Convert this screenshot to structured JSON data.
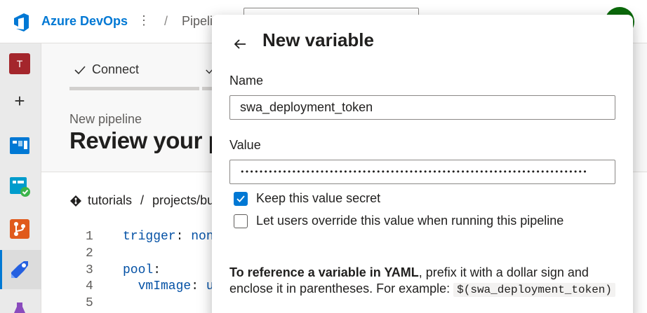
{
  "header": {
    "brand": "Azure DevOps",
    "kebab": "⋮",
    "separator": "/",
    "crumb": "Pipeli"
  },
  "leftnav": {
    "org_initial": "T",
    "plus": "+"
  },
  "main": {
    "steps": [
      {
        "label": "Connect"
      }
    ],
    "subtitle": "New pipeline",
    "title": "Review your p",
    "repo": {
      "org": "tutorials",
      "separator": "/",
      "path": "projects/buil"
    },
    "code": [
      {
        "num": "1",
        "key": "trigger",
        "colon": ":",
        "value": " non"
      },
      {
        "num": "2",
        "key": "",
        "colon": "",
        "value": ""
      },
      {
        "num": "3",
        "key": "pool",
        "colon": ":",
        "value": ""
      },
      {
        "num": "4",
        "key": "  vmImage",
        "colon": ":",
        "value": " u"
      },
      {
        "num": "5",
        "key": "",
        "colon": "",
        "value": ""
      }
    ]
  },
  "dialog": {
    "title": "New variable",
    "name_label": "Name",
    "name_value": "swa_deployment_token",
    "value_label": "Value",
    "value_masked": "••••••••••••••••••••••••••••••••••••••••••••••••••••••••••••••••••••••••••",
    "keep_secret_label": "Keep this value secret",
    "keep_secret_checked": true,
    "override_label": "Let users override this value when running this pipeline",
    "override_checked": false,
    "info_bold": "To reference a variable in YAML",
    "info_text": ", prefix it with a dollar sign and enclose it in parentheses. For example: ",
    "info_code": "$(swa_deployment_token)"
  },
  "colors": {
    "accent": "#0078d4",
    "org_badge": "#a4262c",
    "user_avatar": "#0b6a0b"
  }
}
